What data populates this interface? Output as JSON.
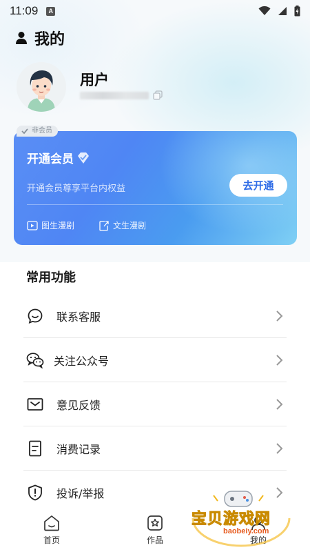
{
  "status_bar": {
    "time": "11:09",
    "notification_letter": "A"
  },
  "header": {
    "title": "我的"
  },
  "profile": {
    "username": "用户"
  },
  "vip": {
    "tag": "非会员",
    "title": "开通会员",
    "subtitle": "开通会员尊享平台内权益",
    "button_label": "去开通",
    "features": [
      "图生漫剧",
      "文生漫剧"
    ],
    "card_color_start": "#5a8ef5",
    "card_color_end": "#7fd0f4"
  },
  "functions": {
    "section_title": "常用功能",
    "items": [
      {
        "label": "联系客服",
        "icon": "headset-chat-icon"
      },
      {
        "label": "关注公众号",
        "icon": "wechat-icon"
      },
      {
        "label": "意见反馈",
        "icon": "mail-icon"
      },
      {
        "label": "消费记录",
        "icon": "receipt-icon"
      },
      {
        "label": "投诉/举报",
        "icon": "shield-alert-icon"
      }
    ]
  },
  "tabbar": {
    "tabs": [
      {
        "label": "首页",
        "icon": "home-icon"
      },
      {
        "label": "作品",
        "icon": "star-box-icon"
      },
      {
        "label": "我的",
        "icon": "user-icon"
      }
    ]
  },
  "watermark": {
    "title": "宝贝游戏网",
    "domain": "baobeiy.com"
  }
}
